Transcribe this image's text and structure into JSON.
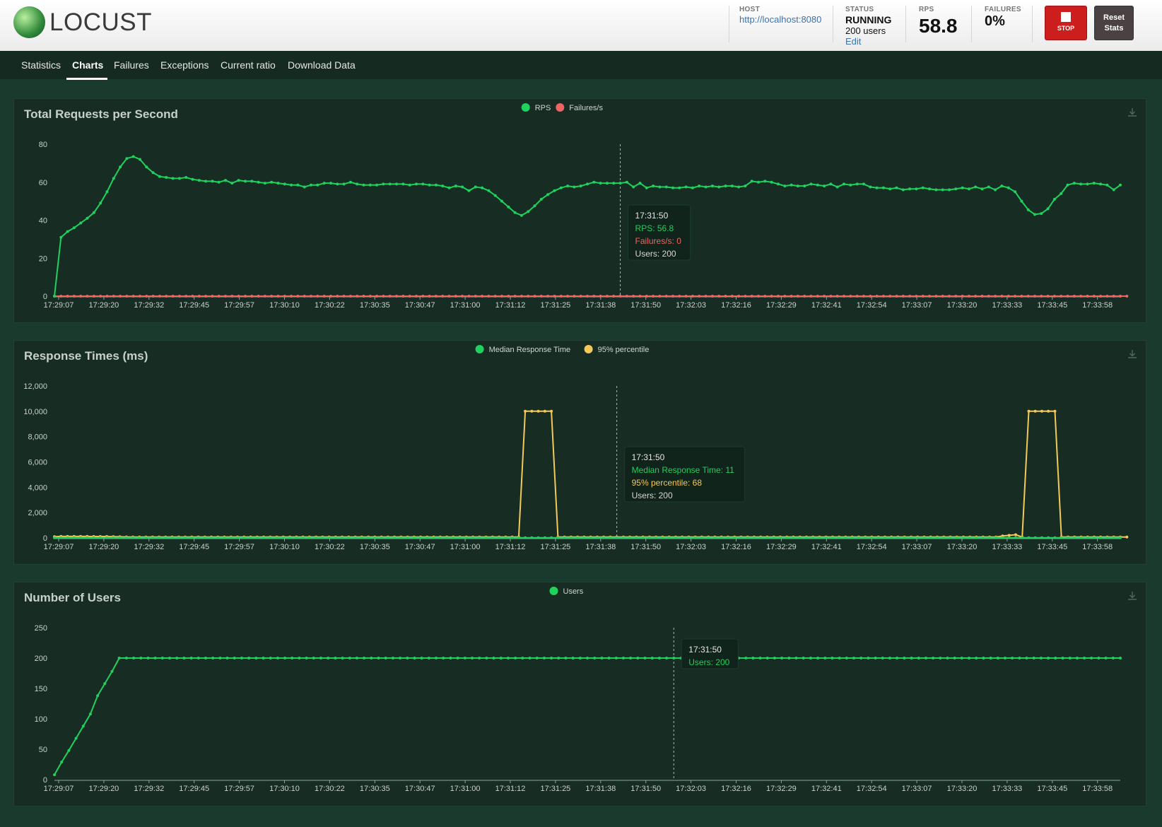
{
  "app": {
    "logo_text": "LOCUST"
  },
  "header": {
    "host_label": "HOST",
    "host_value": "http://localhost:8080",
    "status_label": "STATUS",
    "status_value": "RUNNING",
    "users_text": "200 users",
    "edit_label": "Edit",
    "rps_label": "RPS",
    "rps_value": "58.8",
    "failures_label": "FAILURES",
    "failures_value": "0%",
    "stop_label": "STOP",
    "reset_label_1": "Reset",
    "reset_label_2": "Stats"
  },
  "tabs": [
    {
      "label": "Statistics",
      "active": false
    },
    {
      "label": "Charts",
      "active": true
    },
    {
      "label": "Failures",
      "active": false
    },
    {
      "label": "Exceptions",
      "active": false
    },
    {
      "label": "Current ratio",
      "active": false
    },
    {
      "label": "Download Data",
      "active": false
    }
  ],
  "colors": {
    "green": "#1fd15d",
    "red": "#f06464",
    "yellow": "#f5c85a",
    "grid_bg": "#172d24"
  },
  "x_ticks": [
    "17:29:07",
    "17:29:20",
    "17:29:32",
    "17:29:45",
    "17:29:57",
    "17:30:10",
    "17:30:22",
    "17:30:35",
    "17:30:47",
    "17:31:00",
    "17:31:12",
    "17:31:25",
    "17:31:38",
    "17:31:50",
    "17:32:03",
    "17:32:16",
    "17:32:29",
    "17:32:41",
    "17:32:54",
    "17:33:07",
    "17:33:20",
    "17:33:33",
    "17:33:45",
    "17:33:58"
  ],
  "chart_data": [
    {
      "type": "line",
      "title": "Total Requests per Second",
      "ylim": [
        0,
        80
      ],
      "yticks": [
        "80",
        "60",
        "40",
        "20",
        "0"
      ],
      "legend_position": "top-center",
      "series": [
        {
          "name": "RPS",
          "color": "#1fd15d",
          "values": [
            0,
            31,
            34,
            36,
            38.5,
            41,
            44,
            49,
            55,
            62,
            68,
            72.5,
            73.5,
            72,
            68,
            65,
            63,
            62.5,
            62,
            62,
            62.5,
            61.5,
            61,
            60.5,
            60.5,
            60,
            61,
            59.5,
            61,
            60.5,
            60.5,
            60,
            59.5,
            60,
            59.5,
            59,
            58.5,
            58.5,
            57.5,
            58.5,
            58.5,
            59.5,
            59.5,
            59,
            59,
            60,
            59,
            58.5,
            58.5,
            58.5,
            59,
            59,
            59,
            59,
            58.5,
            59,
            59,
            58.5,
            58.5,
            58,
            57,
            58,
            57.5,
            55.5,
            57.5,
            57,
            55.5,
            53,
            50,
            47,
            44,
            42.5,
            44.5,
            47.5,
            51,
            53.5,
            55.5,
            57,
            58,
            57.5,
            58,
            59,
            60,
            59.5,
            59.5,
            59.5,
            59.5,
            60,
            57.5,
            59.5,
            57,
            58,
            57.5,
            57.5,
            57,
            57,
            57.5,
            57,
            58,
            57.5,
            58,
            57.5,
            58,
            58,
            57.5,
            58,
            60.5,
            60,
            60.5,
            60,
            59,
            58,
            58.5,
            58,
            58,
            59,
            58.5,
            58,
            59,
            57.5,
            59,
            58.5,
            59,
            59,
            57.5,
            57,
            57,
            56.5,
            57,
            56,
            56.5,
            56.5,
            57,
            56.5,
            56,
            56,
            56,
            56.5,
            57,
            56.5,
            57.5,
            56.5,
            57.5,
            56,
            58,
            57,
            55,
            50,
            45.5,
            43,
            43.5,
            46,
            51,
            54,
            58.5,
            59.5,
            59,
            59,
            59.5,
            59,
            58.5,
            56,
            58.5
          ]
        },
        {
          "name": "Failures/s",
          "color": "#f06464",
          "values": [
            0,
            0,
            0,
            0,
            0,
            0,
            0,
            0,
            0,
            0,
            0,
            0,
            0,
            0,
            0,
            0,
            0,
            0,
            0,
            0,
            0,
            0,
            0,
            0,
            0,
            0,
            0,
            0,
            0,
            0,
            0,
            0,
            0,
            0,
            0,
            0,
            0,
            0,
            0,
            0,
            0,
            0,
            0,
            0,
            0,
            0,
            0,
            0,
            0,
            0,
            0,
            0,
            0,
            0,
            0,
            0,
            0,
            0,
            0,
            0,
            0,
            0,
            0,
            0,
            0,
            0,
            0,
            0,
            0,
            0,
            0,
            0,
            0,
            0,
            0,
            0,
            0,
            0,
            0,
            0,
            0,
            0,
            0,
            0,
            0,
            0,
            0,
            0,
            0,
            0,
            0,
            0,
            0,
            0,
            0,
            0,
            0,
            0,
            0,
            0,
            0,
            0,
            0,
            0,
            0,
            0,
            0,
            0,
            0,
            0,
            0,
            0,
            0,
            0,
            0,
            0,
            0,
            0,
            0,
            0,
            0,
            0,
            0,
            0,
            0,
            0,
            0,
            0,
            0,
            0,
            0,
            0,
            0,
            0,
            0,
            0,
            0,
            0,
            0,
            0,
            0,
            0,
            0,
            0,
            0,
            0,
            0,
            0,
            0,
            0,
            0,
            0,
            0,
            0,
            0,
            0,
            0,
            0,
            0,
            0,
            0,
            0,
            0,
            0
          ]
        }
      ],
      "tooltip": {
        "time": "17:31:50",
        "lines": [
          {
            "text": "RPS: 56.8",
            "color": "#1fd15d"
          },
          {
            "text": "Failures/s: 0",
            "color": "#f06464"
          },
          {
            "text": "Users: 200",
            "color": "#d6d6d6"
          }
        ]
      },
      "hover_index": 86
    },
    {
      "type": "line",
      "title": "Response Times (ms)",
      "ylim": [
        0,
        12000
      ],
      "yticks": [
        "12,000",
        "10,000",
        "8,000",
        "6,000",
        "4,000",
        "2,000",
        "0"
      ],
      "legend_position": "top-center",
      "series": [
        {
          "name": "Median Response Time",
          "color": "#1fd15d",
          "values": [
            11,
            11,
            11,
            11,
            11,
            11,
            11,
            11,
            11,
            11,
            11,
            11,
            11,
            11,
            11,
            11,
            11,
            11,
            11,
            11,
            11,
            11,
            11,
            11,
            11,
            11,
            11,
            11,
            11,
            11,
            11,
            11,
            11,
            11,
            11,
            11,
            11,
            11,
            11,
            11,
            11,
            11,
            11,
            11,
            11,
            11,
            11,
            11,
            11,
            11,
            11,
            11,
            11,
            11,
            11,
            11,
            11,
            11,
            11,
            11,
            11,
            11,
            11,
            11,
            11,
            11,
            11,
            11,
            11,
            11,
            11,
            11,
            11,
            11,
            11,
            11,
            11,
            11,
            11,
            11,
            11,
            11,
            11,
            11,
            11,
            11,
            11,
            11,
            11,
            11,
            11,
            11,
            11,
            11,
            11,
            11,
            11,
            11,
            11,
            11,
            11,
            11,
            11,
            11,
            11,
            11,
            11,
            11,
            11,
            11,
            11,
            11,
            11,
            11,
            11,
            11,
            11,
            11,
            11,
            11,
            11,
            11,
            11,
            11,
            11,
            11,
            11,
            11,
            11,
            11,
            11,
            11,
            11,
            11,
            11,
            11,
            11,
            11,
            11,
            11,
            11,
            11,
            11,
            11,
            11,
            11,
            11,
            11,
            11,
            11,
            11,
            11,
            11,
            11,
            11,
            11,
            11,
            11,
            11,
            11,
            11,
            11,
            11,
            11
          ]
        },
        {
          "name": "95% percentile",
          "color": "#f5c85a",
          "values": [
            100,
            120,
            120,
            120,
            120,
            120,
            110,
            110,
            110,
            100,
            90,
            80,
            70,
            70,
            68,
            68,
            68,
            68,
            68,
            68,
            68,
            68,
            68,
            68,
            68,
            68,
            68,
            68,
            68,
            68,
            68,
            68,
            68,
            68,
            68,
            68,
            68,
            68,
            68,
            68,
            68,
            68,
            68,
            68,
            68,
            68,
            68,
            68,
            68,
            68,
            68,
            68,
            68,
            68,
            68,
            68,
            68,
            68,
            68,
            68,
            68,
            68,
            68,
            68,
            68,
            68,
            68,
            68,
            68,
            68,
            68,
            68,
            10000,
            10000,
            10000,
            10000,
            10000,
            68,
            68,
            68,
            68,
            68,
            68,
            68,
            68,
            68,
            68,
            68,
            68,
            68,
            68,
            68,
            68,
            68,
            68,
            68,
            68,
            68,
            68,
            68,
            68,
            68,
            68,
            68,
            68,
            68,
            68,
            68,
            68,
            68,
            68,
            68,
            68,
            68,
            68,
            68,
            68,
            68,
            68,
            68,
            68,
            68,
            68,
            68,
            68,
            68,
            68,
            68,
            68,
            68,
            68,
            68,
            68,
            68,
            68,
            68,
            68,
            68,
            68,
            68,
            68,
            68,
            68,
            68,
            68,
            150,
            200,
            250,
            68,
            10000,
            10000,
            10000,
            10000,
            10000,
            68,
            68,
            68,
            68,
            68,
            68,
            68,
            68,
            68,
            68,
            68
          ]
        }
      ],
      "tooltip": {
        "time": "17:31:50",
        "lines": [
          {
            "text": "Median Response Time: 11",
            "color": "#1fd15d"
          },
          {
            "text": "95% percentile: 68",
            "color": "#f5c85a"
          },
          {
            "text": "Users: 200",
            "color": "#d6d6d6"
          }
        ]
      },
      "hover_index": 86
    },
    {
      "type": "line",
      "title": "Number of Users",
      "ylim": [
        0,
        250
      ],
      "yticks": [
        "250",
        "200",
        "150",
        "100",
        "50",
        "0"
      ],
      "legend_position": "top-center",
      "series": [
        {
          "name": "Users",
          "color": "#1fd15d",
          "values": [
            8,
            29,
            48,
            68,
            88,
            108,
            138,
            158,
            178,
            200,
            200,
            200,
            200,
            200,
            200,
            200,
            200,
            200,
            200,
            200,
            200,
            200,
            200,
            200,
            200,
            200,
            200,
            200,
            200,
            200,
            200,
            200,
            200,
            200,
            200,
            200,
            200,
            200,
            200,
            200,
            200,
            200,
            200,
            200,
            200,
            200,
            200,
            200,
            200,
            200,
            200,
            200,
            200,
            200,
            200,
            200,
            200,
            200,
            200,
            200,
            200,
            200,
            200,
            200,
            200,
            200,
            200,
            200,
            200,
            200,
            200,
            200,
            200,
            200,
            200,
            200,
            200,
            200,
            200,
            200,
            200,
            200,
            200,
            200,
            200,
            200,
            200,
            200,
            200,
            200,
            200,
            200,
            200,
            200,
            200,
            200,
            200,
            200,
            200,
            200,
            200,
            200,
            200,
            200,
            200,
            200,
            200,
            200,
            200,
            200,
            200,
            200,
            200,
            200,
            200,
            200,
            200,
            200,
            200,
            200,
            200,
            200,
            200,
            200,
            200,
            200,
            200,
            200,
            200,
            200,
            200,
            200,
            200,
            200,
            200,
            200,
            200,
            200,
            200,
            200,
            200,
            200,
            200,
            200,
            200,
            200,
            200,
            200,
            200
          ]
        }
      ],
      "tooltip": {
        "time": "17:31:50",
        "lines": [
          {
            "text": "Users: 200",
            "color": "#1fd15d"
          }
        ]
      },
      "hover_index": 86
    }
  ]
}
